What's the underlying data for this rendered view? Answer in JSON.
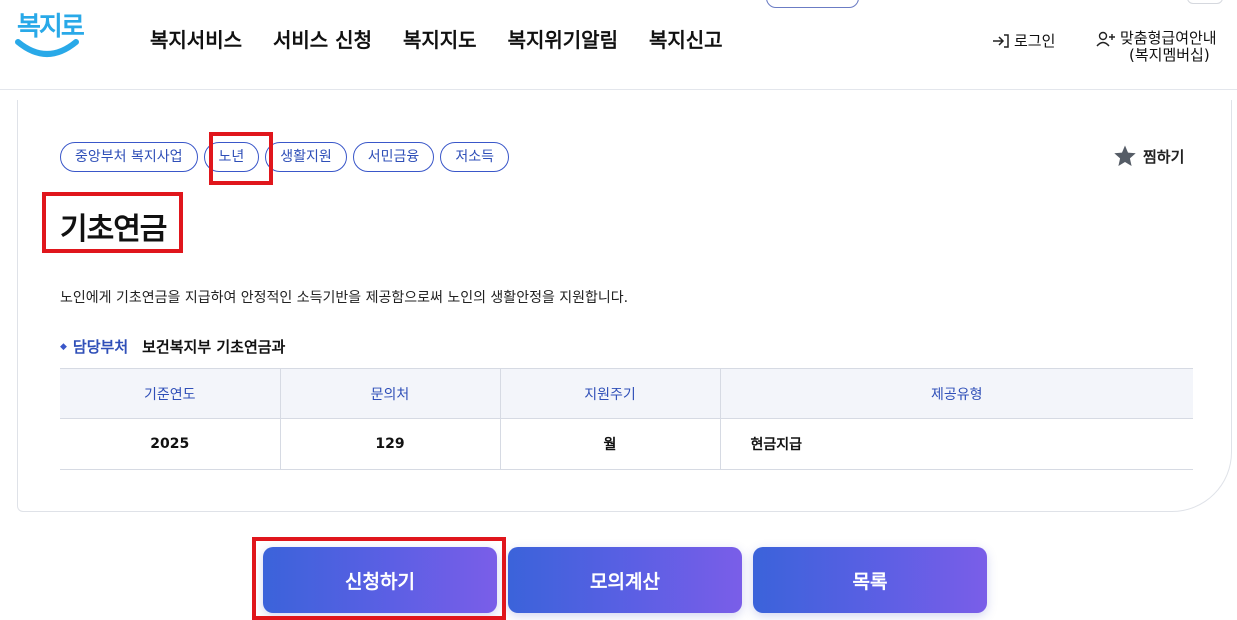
{
  "header": {
    "logo_text": "복지로",
    "nav": [
      "복지서비스",
      "서비스 신청",
      "복지지도",
      "복지위기알림",
      "복지신고"
    ],
    "login_label": "로그인",
    "member_line1": "맞춤형급여안내",
    "member_line2": "(복지멤버십)"
  },
  "service": {
    "tags": [
      "중앙부처 복지사업",
      "노년",
      "생활지원",
      "서민금융",
      "저소득"
    ],
    "favorite_label": "찜하기",
    "title": "기초연금",
    "description": "노인에게 기초연금을 지급하여 안정적인 소득기반을 제공함으로써 노인의 생활안정을 지원합니다.",
    "dept_label": "담당부처",
    "dept_value": "보건복지부 기초연금과"
  },
  "table": {
    "headers": [
      "기준연도",
      "문의처",
      "지원주기",
      "제공유형"
    ],
    "row": [
      "2025",
      "129",
      "월",
      "현금지급"
    ]
  },
  "buttons": {
    "apply": "신청하기",
    "simulate": "모의계산",
    "list": "목록"
  },
  "colors": {
    "accent": "#3a57c9",
    "highlight": "#e0161c",
    "logo": "#29a9e8"
  }
}
